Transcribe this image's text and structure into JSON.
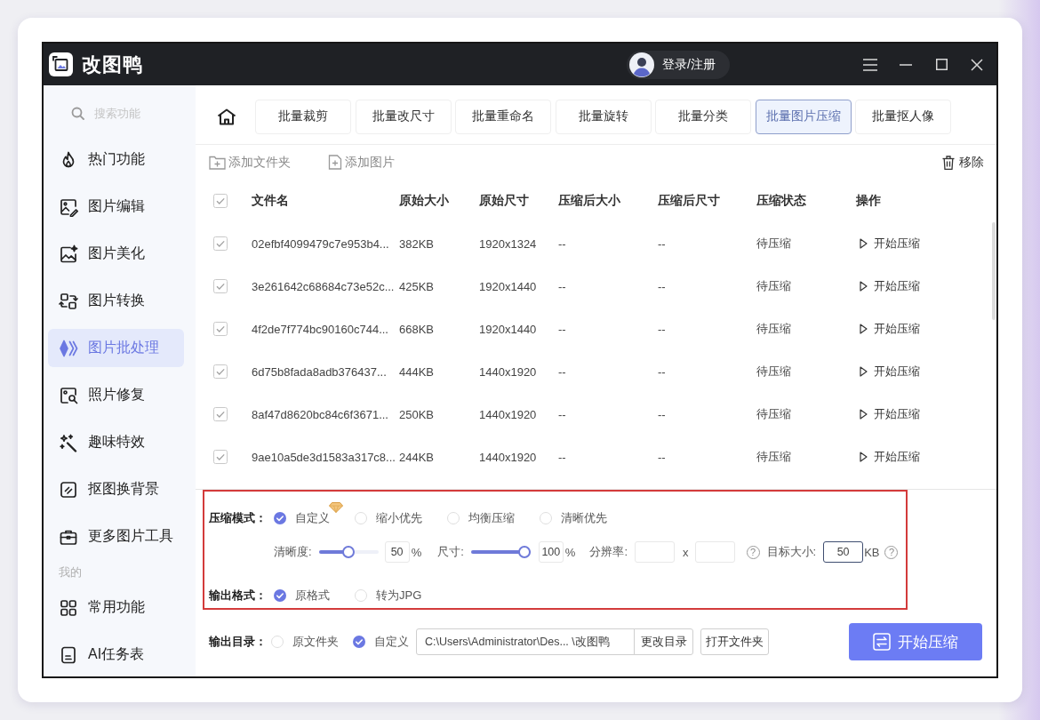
{
  "window": {
    "app_name": "改图鸭",
    "login": "登录/注册"
  },
  "sidebar": {
    "search_placeholder": "搜索功能",
    "items": [
      {
        "label": "热门功能",
        "selected": false
      },
      {
        "label": "图片编辑",
        "selected": false
      },
      {
        "label": "图片美化",
        "selected": false
      },
      {
        "label": "图片转换",
        "selected": false
      },
      {
        "label": "图片批处理",
        "selected": true
      },
      {
        "label": "照片修复",
        "selected": false
      },
      {
        "label": "趣味特效",
        "selected": false
      },
      {
        "label": "抠图换背景",
        "selected": false
      },
      {
        "label": "更多图片工具",
        "selected": false
      }
    ],
    "section_label": "我的",
    "section_items": [
      {
        "label": "常用功能",
        "selected": false
      },
      {
        "label": "AI任务表",
        "selected": false
      }
    ]
  },
  "tabs": [
    {
      "label": "批量裁剪",
      "selected": false
    },
    {
      "label": "批量改尺寸",
      "selected": false
    },
    {
      "label": "批量重命名",
      "selected": false
    },
    {
      "label": "批量旋转",
      "selected": false
    },
    {
      "label": "批量分类",
      "selected": false
    },
    {
      "label": "批量图片压缩",
      "selected": true
    },
    {
      "label": "批量抠人像",
      "selected": false
    }
  ],
  "toolbar": {
    "add_folder": "添加文件夹",
    "add_image": "添加图片",
    "remove": "移除"
  },
  "table": {
    "all_checked": true,
    "columns": [
      "文件名",
      "原始大小",
      "原始尺寸",
      "压缩后大小",
      "压缩后尺寸",
      "压缩状态",
      "操作"
    ],
    "rows": [
      {
        "checked": true,
        "cells": [
          "02efbf4099479c7e953b4...",
          "382KB",
          "1920x1324",
          "--",
          "--",
          "待压缩"
        ],
        "action": "开始压缩"
      },
      {
        "checked": true,
        "cells": [
          "3e261642c68684c73e52c...",
          "425KB",
          "1920x1440",
          "--",
          "--",
          "待压缩"
        ],
        "action": "开始压缩"
      },
      {
        "checked": true,
        "cells": [
          "4f2de7f774bc90160c744...",
          "668KB",
          "1920x1440",
          "--",
          "--",
          "待压缩"
        ],
        "action": "开始压缩"
      },
      {
        "checked": true,
        "cells": [
          "6d75b8fada8adb376437...",
          "444KB",
          "1440x1920",
          "--",
          "--",
          "待压缩"
        ],
        "action": "开始压缩"
      },
      {
        "checked": true,
        "cells": [
          "8af47d8620bc84c6f3671...",
          "250KB",
          "1440x1920",
          "--",
          "--",
          "待压缩"
        ],
        "action": "开始压缩"
      },
      {
        "checked": true,
        "cells": [
          "9ae10a5de3d1583a317c8...",
          "244KB",
          "1440x1920",
          "--",
          "--",
          "待压缩"
        ],
        "action": "开始压缩"
      }
    ]
  },
  "compression": {
    "highlighted": true,
    "mode_label": "压缩模式：",
    "modes": [
      {
        "label": "自定义",
        "selected": true,
        "vip": true
      },
      {
        "label": "缩小优先",
        "selected": false,
        "vip": false
      },
      {
        "label": "均衡压缩",
        "selected": false,
        "vip": false
      },
      {
        "label": "清晰优先",
        "selected": false,
        "vip": false
      }
    ],
    "clarity": {
      "label": "清晰度:",
      "level": 0.5,
      "value": "50",
      "unit": "%"
    },
    "size": {
      "label": "尺寸:",
      "level": 1,
      "value": "100",
      "unit": "%"
    },
    "resolution": {
      "label": "分辨率:",
      "separator": "x",
      "help": "?"
    },
    "target_size": {
      "label": "目标大小:",
      "value": "50",
      "unit": "KB",
      "help": "?"
    },
    "format_label": "输出格式：",
    "formats": [
      {
        "label": "原格式",
        "selected": true
      },
      {
        "label": "转为JPG",
        "selected": false
      }
    ]
  },
  "output": {
    "label": "输出目录：",
    "options": [
      {
        "label": "原文件夹",
        "selected": false
      },
      {
        "label": "自定义",
        "selected": true
      }
    ],
    "path": "C:\\Users\\Administrator\\Des... \\改图鸭",
    "change_button": "更改目录",
    "open_button": "打开文件夹"
  },
  "start_button": "开始压缩"
}
